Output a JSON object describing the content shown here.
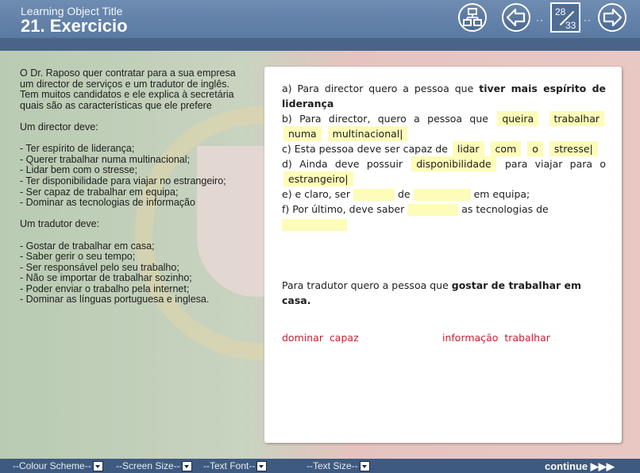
{
  "header": {
    "learning_object_title": "Learning Object Title",
    "page_title": "21. Exercicio",
    "counter_current": "28",
    "counter_total": "33",
    "dots": "··"
  },
  "instructions": {
    "intro": "O Dr. Raposo quer contratar para a sua empresa um director de serviços e um tradutor de inglês. Tem muitos candidatos e ele explica à secretária quais são as características que ele prefere",
    "director_heading": "Um director deve:",
    "director_items": [
      "- Ter espírito de liderança;",
      "- Querer trabalhar numa multinacional;",
      "- Lidar bem com o stresse;",
      "- Ter disponibilidade para viajar no estrangeiro;",
      "- Ser capaz de trabalhar em equipa;",
      "- Dominar as tecnologias de informação"
    ],
    "translator_heading": "Um tradutor deve:",
    "translator_items": [
      "- Gostar de trabalhar em casa;",
      "- Saber gerir o seu tempo;",
      "- Ser responsável pelo seu trabalho;",
      "- Não se importar de trabalhar sozinho;",
      "- Poder enviar o trabalho pela internet;",
      "- Dominar as línguas portuguesa e inglesa."
    ]
  },
  "exercise": {
    "a_text": "a) Para director quero a pessoa que",
    "a_bold": "tiver mais espírito de liderança",
    "b_text": "b) Para director, quero a pessoa que",
    "b_blanks": [
      "queira",
      "trabalhar",
      "numa",
      "multinacional|"
    ],
    "c_text": "c) Esta pessoa deve ser capaz de",
    "c_blanks": [
      "lidar",
      "com",
      "o",
      "stresse|"
    ],
    "d_text_1": "d) Ainda deve possuir",
    "d_blank_1": "disponibilidade",
    "d_text_2": "para viajar para o",
    "d_blank_2": "estrangeiro|",
    "e_text_1": "e) e claro, ser",
    "e_text_2": "de",
    "e_text_3": "em equipa;",
    "f_text_1": "f) Por último, deve saber",
    "f_text_2": "as tecnologias de",
    "tradutor_text": "Para tradutor quero a pessoa que",
    "tradutor_bold": "gostar de trabalhar em casa."
  },
  "word_bank": {
    "left": [
      "dominar",
      "capaz"
    ],
    "right": [
      "informação",
      "trabalhar"
    ]
  },
  "footer": {
    "colour_scheme": "--Colour Scheme--",
    "screen_size": "--Screen Size--",
    "text_font": "--Text Font--",
    "text_size": "--Text Size--",
    "continue_label": "continue ▶▶▶"
  },
  "colors": {
    "header": "#5a7aa2",
    "footer": "#3e5a80",
    "blank_highlight": "#fdfcb8",
    "word_bank": "#c8202e"
  },
  "icons": [
    "menu-structure-icon",
    "arrow-left-icon",
    "arrow-right-icon",
    "dropdown-arrow-icon"
  ]
}
